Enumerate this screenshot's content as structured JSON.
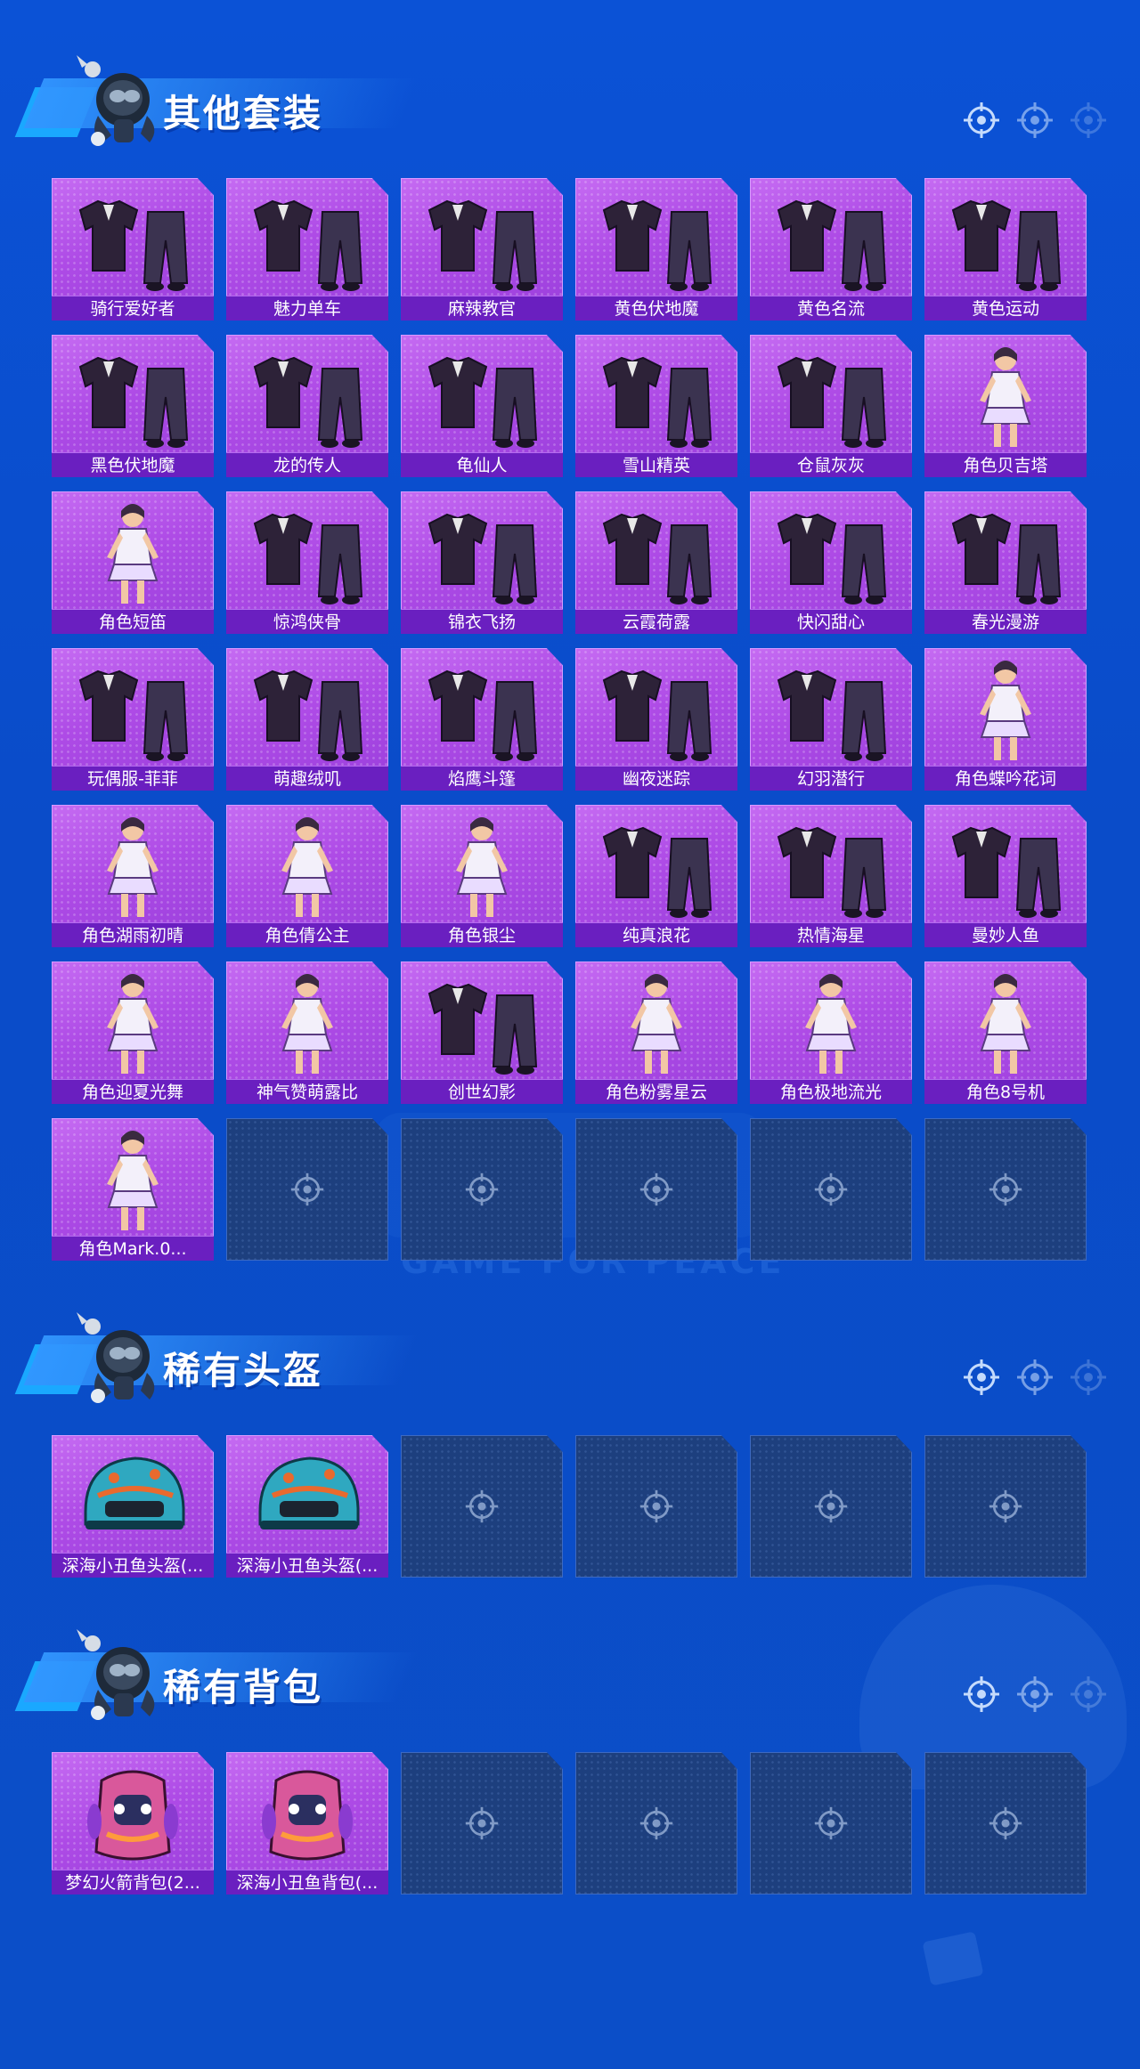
{
  "colors": {
    "background": "#0b52d6",
    "card_purple": "#ae4be6",
    "label_bar": "#6a1fc0",
    "empty_slot": "#1d3f7e"
  },
  "watermark_text": "GAME FOR PEACE",
  "sections": [
    {
      "title": "其他套装",
      "items": [
        {
          "label": "骑行爱好者",
          "art": "outfit-set"
        },
        {
          "label": "魅力单车",
          "art": "outfit-set"
        },
        {
          "label": "麻辣教官",
          "art": "outfit-set"
        },
        {
          "label": "黄色伏地魔",
          "art": "outfit-set"
        },
        {
          "label": "黄色名流",
          "art": "outfit-set"
        },
        {
          "label": "黄色运动",
          "art": "outfit-set"
        },
        {
          "label": "黑色伏地魔",
          "art": "outfit-set"
        },
        {
          "label": "龙的传人",
          "art": "outfit-set"
        },
        {
          "label": "龟仙人",
          "art": "outfit-set"
        },
        {
          "label": "雪山精英",
          "art": "outfit-set"
        },
        {
          "label": "仓鼠灰灰",
          "art": "outfit-set"
        },
        {
          "label": "角色贝吉塔",
          "art": "character"
        },
        {
          "label": "角色短笛",
          "art": "character"
        },
        {
          "label": "惊鸿侠骨",
          "art": "outfit-set"
        },
        {
          "label": "锦衣飞扬",
          "art": "outfit-set"
        },
        {
          "label": "云霞荷露",
          "art": "outfit-set"
        },
        {
          "label": "快闪甜心",
          "art": "outfit-set"
        },
        {
          "label": "春光漫游",
          "art": "outfit-set"
        },
        {
          "label": "玩偶服-菲菲",
          "art": "outfit-set"
        },
        {
          "label": "萌趣绒叽",
          "art": "outfit-set"
        },
        {
          "label": "焰鹰斗篷",
          "art": "outfit-set"
        },
        {
          "label": "幽夜迷踪",
          "art": "outfit-set"
        },
        {
          "label": "幻羽潜行",
          "art": "outfit-set"
        },
        {
          "label": "角色蝶吟花词",
          "art": "character"
        },
        {
          "label": "角色湖雨初晴",
          "art": "character"
        },
        {
          "label": "角色倩公主",
          "art": "character"
        },
        {
          "label": "角色银尘",
          "art": "character"
        },
        {
          "label": "纯真浪花",
          "art": "outfit-set"
        },
        {
          "label": "热情海星",
          "art": "outfit-set"
        },
        {
          "label": "曼妙人鱼",
          "art": "outfit-set"
        },
        {
          "label": "角色迎夏光舞",
          "art": "character"
        },
        {
          "label": "神气赞萌露比",
          "art": "character"
        },
        {
          "label": "创世幻影",
          "art": "outfit-set"
        },
        {
          "label": "角色粉雾星云",
          "art": "character"
        },
        {
          "label": "角色极地流光",
          "art": "character"
        },
        {
          "label": "角色8号机",
          "art": "character"
        },
        {
          "label": "角色Mark.0...",
          "art": "character"
        }
      ]
    },
    {
      "title": "稀有头盔",
      "items": [
        {
          "label": "深海小丑鱼头盔(...",
          "art": "helmet"
        },
        {
          "label": "深海小丑鱼头盔(...",
          "art": "helmet"
        }
      ]
    },
    {
      "title": "稀有背包",
      "items": [
        {
          "label": "梦幻火箭背包(2...",
          "art": "backpack"
        },
        {
          "label": "深海小丑鱼背包(...",
          "art": "backpack"
        }
      ]
    }
  ]
}
